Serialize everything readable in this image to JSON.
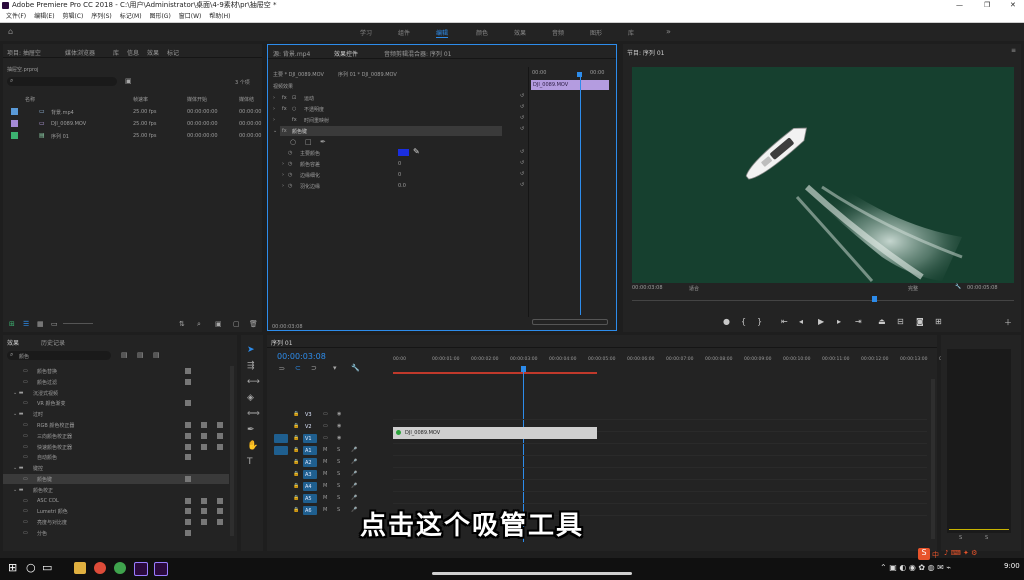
{
  "app": {
    "title": "Adobe Premiere Pro CC 2018 - C:\\用户\\Administrator\\桌面\\4-9素材\\pr\\抽屉空 *",
    "window_controls": [
      "—",
      "❐",
      "✕"
    ]
  },
  "menu": [
    "文件(F)",
    "编辑(E)",
    "剪辑(C)",
    "序列(S)",
    "标记(M)",
    "图形(G)",
    "窗口(W)",
    "帮助(H)"
  ],
  "workspaces": [
    "学习",
    "组件",
    "编辑",
    "颜色",
    "效果",
    "音频",
    "图形",
    "库"
  ],
  "project_panel": {
    "tabs": [
      "项目: 抽屉空",
      "媒体浏览器",
      "库",
      "信息",
      "效果",
      "标记"
    ],
    "project_file": "抽屉空.prproj",
    "item_count": "3 个项",
    "columns": [
      "名称",
      "帧速率",
      "媒体开始",
      "媒体结"
    ],
    "items": [
      {
        "name": "背景.mp4",
        "fps": "25.00 fps",
        "start": "00:00:00:00",
        "end": "00:00:00",
        "color": "#5a9ad8"
      },
      {
        "name": "DJI_0089.MOV",
        "fps": "25.00 fps",
        "start": "00:00:00:00",
        "end": "00:00:00",
        "color": "#a58bd6"
      },
      {
        "name": "序列 01",
        "fps": "25.00 fps",
        "start": "00:00:00:00",
        "end": "00:00:00",
        "color": "#3cb371"
      }
    ]
  },
  "effect_controls": {
    "tabs": [
      "源: 背景.mp4",
      "效果控件",
      "音频剪辑混合器: 序列 01"
    ],
    "master": "主要 * DJI_0089.MOV",
    "sequence": "序列 01 * DJI_0089.MOV",
    "section": "视频效果",
    "timecode": "00:00:03:08",
    "clip_label": "DJI_0089.MOV",
    "ruler": [
      "00:00",
      "00:00"
    ],
    "effects": [
      {
        "name": "运动"
      },
      {
        "name": "不透明度"
      },
      {
        "name": "时间重映射"
      },
      {
        "name": "颜色键"
      }
    ],
    "params": [
      {
        "name": "主要颜色",
        "value": ""
      },
      {
        "name": "颜色容差",
        "value": "0"
      },
      {
        "name": "边缘细化",
        "value": "0"
      },
      {
        "name": "羽化边缘",
        "value": "0.0"
      }
    ]
  },
  "program_monitor": {
    "tab": "节目: 序列 01",
    "timecode_left": "00:00:03:08",
    "fit": "适合",
    "quality": "完整",
    "timecode_right": "00:00:05:08"
  },
  "effects_panel": {
    "tabs": [
      "效果",
      "历史记录"
    ],
    "search": "颜色",
    "items": [
      {
        "label": "颜色替换",
        "indent": 2
      },
      {
        "label": "颜色过滤",
        "indent": 2
      },
      {
        "label": "沉浸式视频",
        "indent": 1
      },
      {
        "label": "VR 颜色渐变",
        "indent": 2
      },
      {
        "label": "过时",
        "indent": 1
      },
      {
        "label": "RGB 颜色校正器",
        "indent": 2
      },
      {
        "label": "三向颜色校正器",
        "indent": 2
      },
      {
        "label": "快速颜色校正器",
        "indent": 2
      },
      {
        "label": "自动颜色",
        "indent": 2
      },
      {
        "label": "键控",
        "indent": 1
      },
      {
        "label": "颜色键",
        "indent": 2,
        "selected": true
      },
      {
        "label": "颜色校正",
        "indent": 1
      },
      {
        "label": "ASC CDL",
        "indent": 2
      },
      {
        "label": "Lumetri 颜色",
        "indent": 2
      },
      {
        "label": "亮度与对比度",
        "indent": 2
      },
      {
        "label": "分色",
        "indent": 2
      }
    ]
  },
  "timeline": {
    "tab": "序列 01",
    "timecode": "00:00:03:08",
    "ruler": [
      "00:00",
      "00:00:01:00",
      "00:00:02:00",
      "00:00:03:00",
      "00:00:04:00",
      "00:00:05:00",
      "00:00:06:00",
      "00:00:07:00",
      "00:00:08:00",
      "00:00:09:00",
      "00:00:10:00",
      "00:00:11:00",
      "00:00:12:00",
      "00:00:13:00",
      "00:00:14:00"
    ],
    "video_tracks": [
      "V3",
      "V2",
      "V1"
    ],
    "audio_tracks": [
      "A1",
      "A2",
      "A3",
      "A4",
      "A5",
      "A6"
    ],
    "clip": "DJI_0089.MOV",
    "meter_scale": [
      "S",
      "S"
    ]
  },
  "subtitle": "点击这个吸管工具",
  "taskbar": {
    "ime": "中",
    "time": "9:00"
  }
}
